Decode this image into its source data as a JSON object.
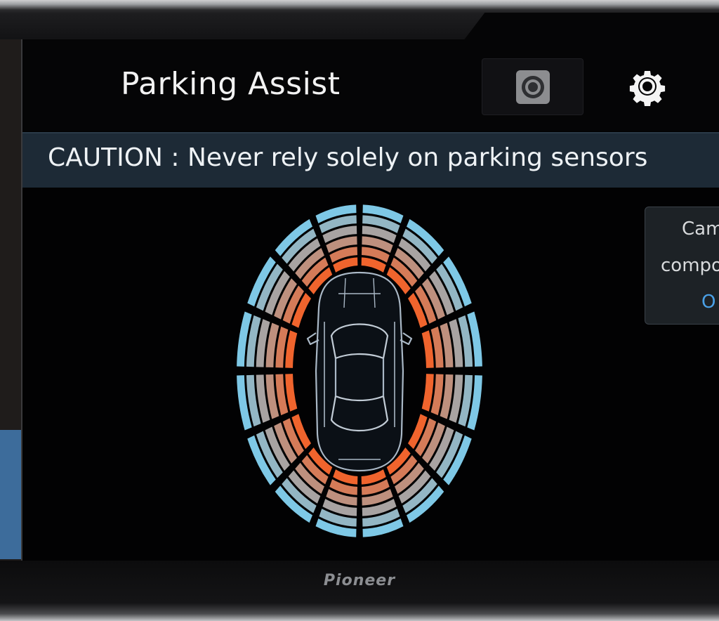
{
  "header": {
    "title": "Parking Assist",
    "camera_icon": "camera-icon",
    "settings_icon": "gear-icon"
  },
  "caution": {
    "text": "CAUTION : Never rely solely on parking sensors"
  },
  "popup": {
    "line1": "Cam",
    "line2": "compo",
    "link": "O"
  },
  "device": {
    "brand": "Pioneer"
  },
  "colors": {
    "near": "#f0642d",
    "far": "#7ec8e6",
    "caution_bg": "#1d2a36",
    "accent_blue": "#4aa0e6"
  },
  "sensor_display": {
    "rings": 6,
    "sectors": 16,
    "car_icon": "car-top-view-icon"
  }
}
